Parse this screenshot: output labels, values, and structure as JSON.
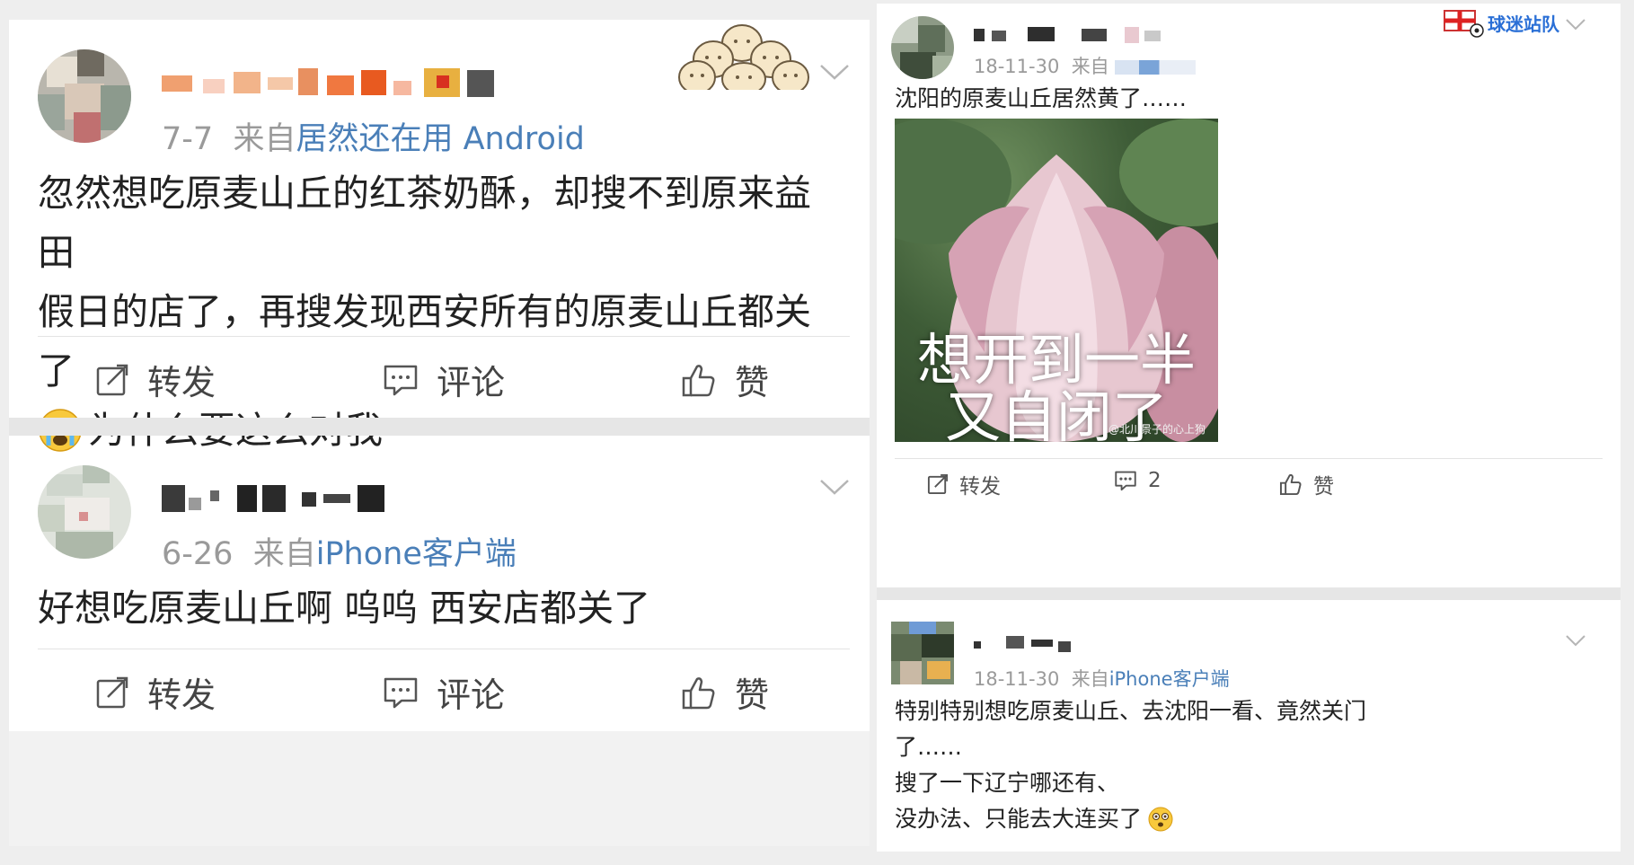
{
  "posts_left": [
    {
      "meta_time": "7-7",
      "meta_from": "来自",
      "meta_source": "居然还在用 Android",
      "text_lines": [
        "忽然想吃原麦山丘的红茶奶酥，却搜不到原来益田",
        "假日的店了，再搜发现西安所有的原麦山丘都关了",
        "为什么要这么对我"
      ],
      "emoji": "crying-face",
      "actions": {
        "repost": "转发",
        "comment": "评论",
        "like": "赞"
      }
    },
    {
      "meta_time": "6-26",
      "meta_from": "来自",
      "meta_source": "iPhone客户端",
      "text_lines": [
        "好想吃原麦山丘啊 呜呜 西安店都关了"
      ],
      "actions": {
        "repost": "转发",
        "comment": "评论",
        "like": "赞"
      }
    }
  ],
  "posts_right": [
    {
      "meta_time": "18-11-30",
      "meta_from": "来自",
      "text_lines": [
        "沈阳的原麦山丘居然黄了……"
      ],
      "image": {
        "caption_line1": "想开到一半",
        "caption_line2": "又自闭了",
        "watermark": "@北川景子的心上狗"
      },
      "actions": {
        "repost": "转发",
        "comment": "2",
        "like": "赞"
      }
    },
    {
      "meta_time": "18-11-30",
      "meta_from": "来自",
      "meta_source": "iPhone客户端",
      "text_lines": [
        "特别特别想吃原麦山丘、去沈阳一看、竟然关门",
        "了……",
        "搜了一下辽宁哪还有、",
        "没办法、只能去大连买了"
      ],
      "emoji": "flushed-face"
    }
  ],
  "brand_badge": {
    "text": "球迷站队",
    "color": "#2a6fd6"
  },
  "colors": {
    "link": "#4a7fb8",
    "meta": "#9a9a9a",
    "text": "#222222"
  }
}
